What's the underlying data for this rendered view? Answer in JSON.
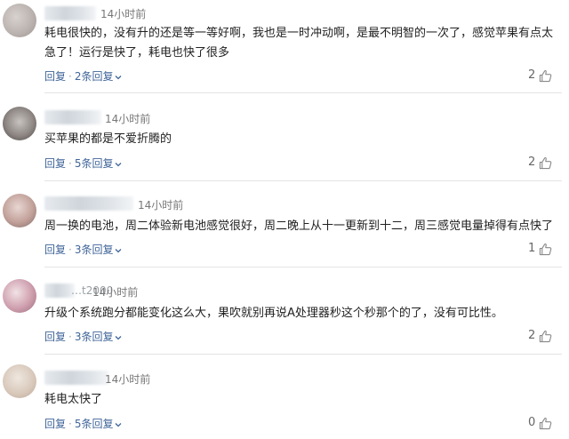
{
  "comments": [
    {
      "time": "14小时前",
      "text": "耗电很快的，没有升的还是等一等好啊，我也是一时冲动啊，是最不明智的一次了，感觉苹果有点太急了！运行是快了，耗电也快了很多",
      "reply_label": "回复",
      "replies_label": "2条回复",
      "likes": "2"
    },
    {
      "time": "14小时前",
      "text": "买苹果的都是不爱折腾的",
      "reply_label": "回复",
      "replies_label": "5条回复",
      "likes": "2"
    },
    {
      "time": "14小时前",
      "text": "周一换的电池，周二体验新电池感觉很好，周二晚上从十一更新到十二，周三感觉电量掉得有点快了",
      "reply_label": "回复",
      "replies_label": "3条回复",
      "likes": "1"
    },
    {
      "name_fragment": "…t2000",
      "time": "14小时前",
      "text": "升级个系统跑分都能变化这么大，果吹就别再说A处理器秒这个秒那个的了，没有可比性。",
      "reply_label": "回复",
      "replies_label": "3条回复",
      "likes": "2"
    },
    {
      "time": "14小时前",
      "text": "耗电太快了",
      "reply_label": "回复",
      "replies_label": "5条回复",
      "likes": "0"
    }
  ],
  "icons": {
    "like": "thumbs-up-icon",
    "expand": "chevron-down-icon"
  },
  "colors": {
    "link": "#406599",
    "text": "#222222",
    "meta": "#777777",
    "divider": "#e4e4e4"
  }
}
